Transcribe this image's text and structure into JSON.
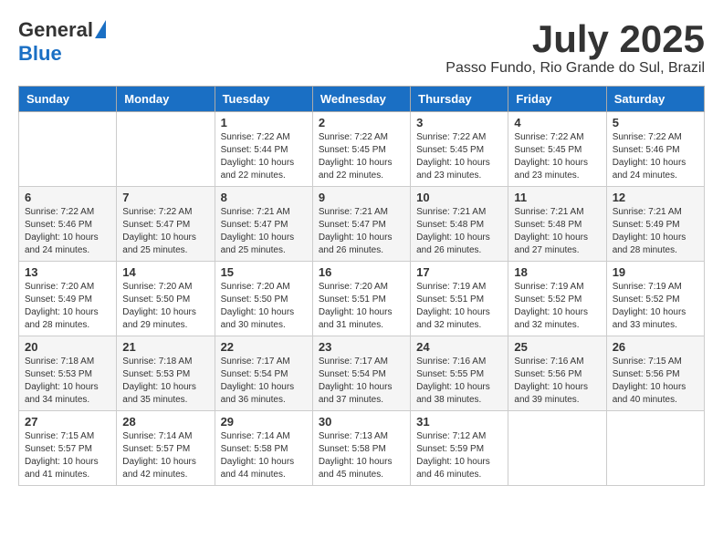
{
  "logo": {
    "general": "General",
    "blue": "Blue"
  },
  "title": "July 2025",
  "location": "Passo Fundo, Rio Grande do Sul, Brazil",
  "weekdays": [
    "Sunday",
    "Monday",
    "Tuesday",
    "Wednesday",
    "Thursday",
    "Friday",
    "Saturday"
  ],
  "weeks": [
    [
      {
        "day": "",
        "info": ""
      },
      {
        "day": "",
        "info": ""
      },
      {
        "day": "1",
        "info": "Sunrise: 7:22 AM\nSunset: 5:44 PM\nDaylight: 10 hours and 22 minutes."
      },
      {
        "day": "2",
        "info": "Sunrise: 7:22 AM\nSunset: 5:45 PM\nDaylight: 10 hours and 22 minutes."
      },
      {
        "day": "3",
        "info": "Sunrise: 7:22 AM\nSunset: 5:45 PM\nDaylight: 10 hours and 23 minutes."
      },
      {
        "day": "4",
        "info": "Sunrise: 7:22 AM\nSunset: 5:45 PM\nDaylight: 10 hours and 23 minutes."
      },
      {
        "day": "5",
        "info": "Sunrise: 7:22 AM\nSunset: 5:46 PM\nDaylight: 10 hours and 24 minutes."
      }
    ],
    [
      {
        "day": "6",
        "info": "Sunrise: 7:22 AM\nSunset: 5:46 PM\nDaylight: 10 hours and 24 minutes."
      },
      {
        "day": "7",
        "info": "Sunrise: 7:22 AM\nSunset: 5:47 PM\nDaylight: 10 hours and 25 minutes."
      },
      {
        "day": "8",
        "info": "Sunrise: 7:21 AM\nSunset: 5:47 PM\nDaylight: 10 hours and 25 minutes."
      },
      {
        "day": "9",
        "info": "Sunrise: 7:21 AM\nSunset: 5:47 PM\nDaylight: 10 hours and 26 minutes."
      },
      {
        "day": "10",
        "info": "Sunrise: 7:21 AM\nSunset: 5:48 PM\nDaylight: 10 hours and 26 minutes."
      },
      {
        "day": "11",
        "info": "Sunrise: 7:21 AM\nSunset: 5:48 PM\nDaylight: 10 hours and 27 minutes."
      },
      {
        "day": "12",
        "info": "Sunrise: 7:21 AM\nSunset: 5:49 PM\nDaylight: 10 hours and 28 minutes."
      }
    ],
    [
      {
        "day": "13",
        "info": "Sunrise: 7:20 AM\nSunset: 5:49 PM\nDaylight: 10 hours and 28 minutes."
      },
      {
        "day": "14",
        "info": "Sunrise: 7:20 AM\nSunset: 5:50 PM\nDaylight: 10 hours and 29 minutes."
      },
      {
        "day": "15",
        "info": "Sunrise: 7:20 AM\nSunset: 5:50 PM\nDaylight: 10 hours and 30 minutes."
      },
      {
        "day": "16",
        "info": "Sunrise: 7:20 AM\nSunset: 5:51 PM\nDaylight: 10 hours and 31 minutes."
      },
      {
        "day": "17",
        "info": "Sunrise: 7:19 AM\nSunset: 5:51 PM\nDaylight: 10 hours and 32 minutes."
      },
      {
        "day": "18",
        "info": "Sunrise: 7:19 AM\nSunset: 5:52 PM\nDaylight: 10 hours and 32 minutes."
      },
      {
        "day": "19",
        "info": "Sunrise: 7:19 AM\nSunset: 5:52 PM\nDaylight: 10 hours and 33 minutes."
      }
    ],
    [
      {
        "day": "20",
        "info": "Sunrise: 7:18 AM\nSunset: 5:53 PM\nDaylight: 10 hours and 34 minutes."
      },
      {
        "day": "21",
        "info": "Sunrise: 7:18 AM\nSunset: 5:53 PM\nDaylight: 10 hours and 35 minutes."
      },
      {
        "day": "22",
        "info": "Sunrise: 7:17 AM\nSunset: 5:54 PM\nDaylight: 10 hours and 36 minutes."
      },
      {
        "day": "23",
        "info": "Sunrise: 7:17 AM\nSunset: 5:54 PM\nDaylight: 10 hours and 37 minutes."
      },
      {
        "day": "24",
        "info": "Sunrise: 7:16 AM\nSunset: 5:55 PM\nDaylight: 10 hours and 38 minutes."
      },
      {
        "day": "25",
        "info": "Sunrise: 7:16 AM\nSunset: 5:56 PM\nDaylight: 10 hours and 39 minutes."
      },
      {
        "day": "26",
        "info": "Sunrise: 7:15 AM\nSunset: 5:56 PM\nDaylight: 10 hours and 40 minutes."
      }
    ],
    [
      {
        "day": "27",
        "info": "Sunrise: 7:15 AM\nSunset: 5:57 PM\nDaylight: 10 hours and 41 minutes."
      },
      {
        "day": "28",
        "info": "Sunrise: 7:14 AM\nSunset: 5:57 PM\nDaylight: 10 hours and 42 minutes."
      },
      {
        "day": "29",
        "info": "Sunrise: 7:14 AM\nSunset: 5:58 PM\nDaylight: 10 hours and 44 minutes."
      },
      {
        "day": "30",
        "info": "Sunrise: 7:13 AM\nSunset: 5:58 PM\nDaylight: 10 hours and 45 minutes."
      },
      {
        "day": "31",
        "info": "Sunrise: 7:12 AM\nSunset: 5:59 PM\nDaylight: 10 hours and 46 minutes."
      },
      {
        "day": "",
        "info": ""
      },
      {
        "day": "",
        "info": ""
      }
    ]
  ]
}
